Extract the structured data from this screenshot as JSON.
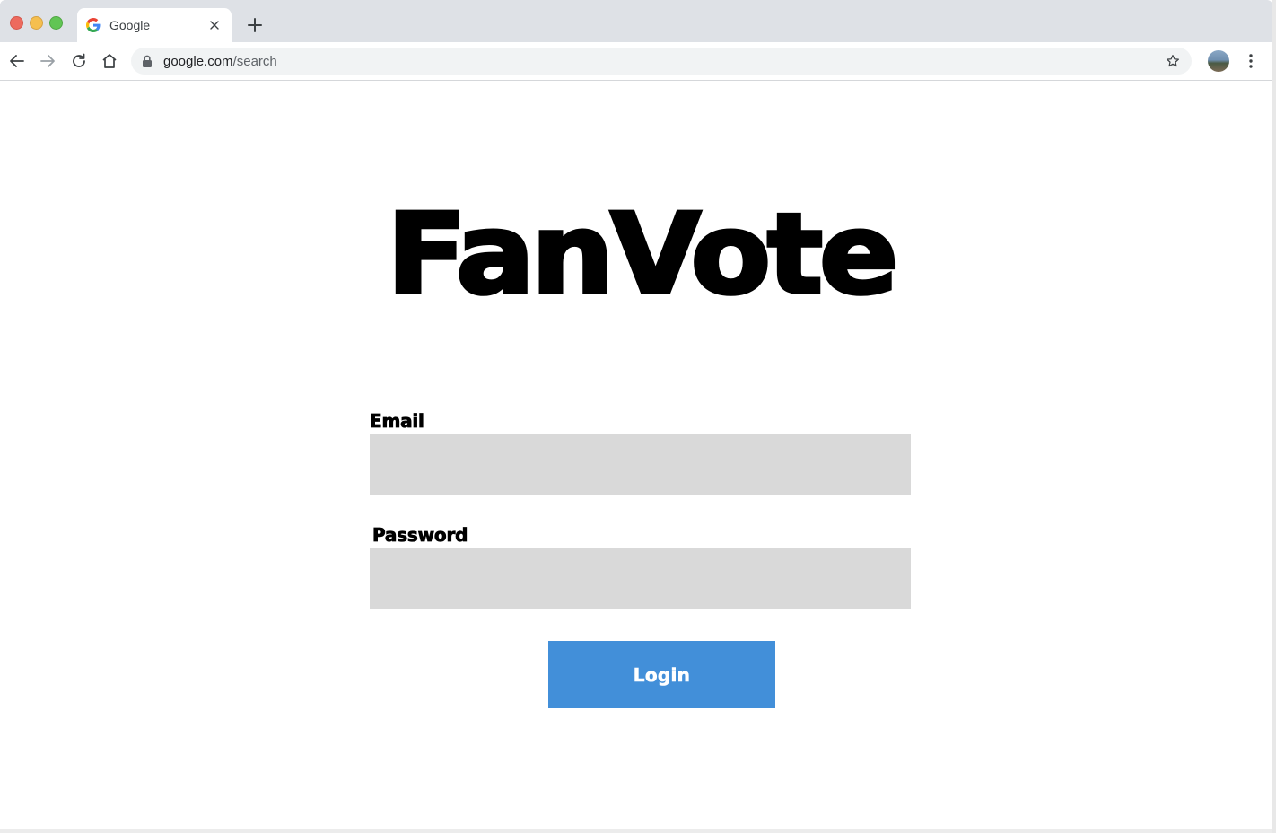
{
  "browser": {
    "tab": {
      "title": "Google",
      "favicon": "google-g-icon"
    },
    "address_bar": {
      "domain": "google.com",
      "path": "/search"
    },
    "icons": [
      "back-icon",
      "forward-icon",
      "reload-icon",
      "home-icon",
      "lock-icon",
      "star-icon",
      "profile-avatar",
      "menu-kebab-icon",
      "new-tab-icon",
      "close-tab-icon"
    ]
  },
  "page": {
    "logo_text": "FanVote",
    "email": {
      "label": "Email",
      "value": "",
      "placeholder": ""
    },
    "password": {
      "label": "Password",
      "value": "",
      "placeholder": ""
    },
    "login_button": "Login"
  },
  "colors": {
    "tabstrip": "#dee1e6",
    "field_background": "#d9d9d9",
    "button_background": "#428fd9",
    "button_text": "#ffffff",
    "text": "#000000"
  }
}
